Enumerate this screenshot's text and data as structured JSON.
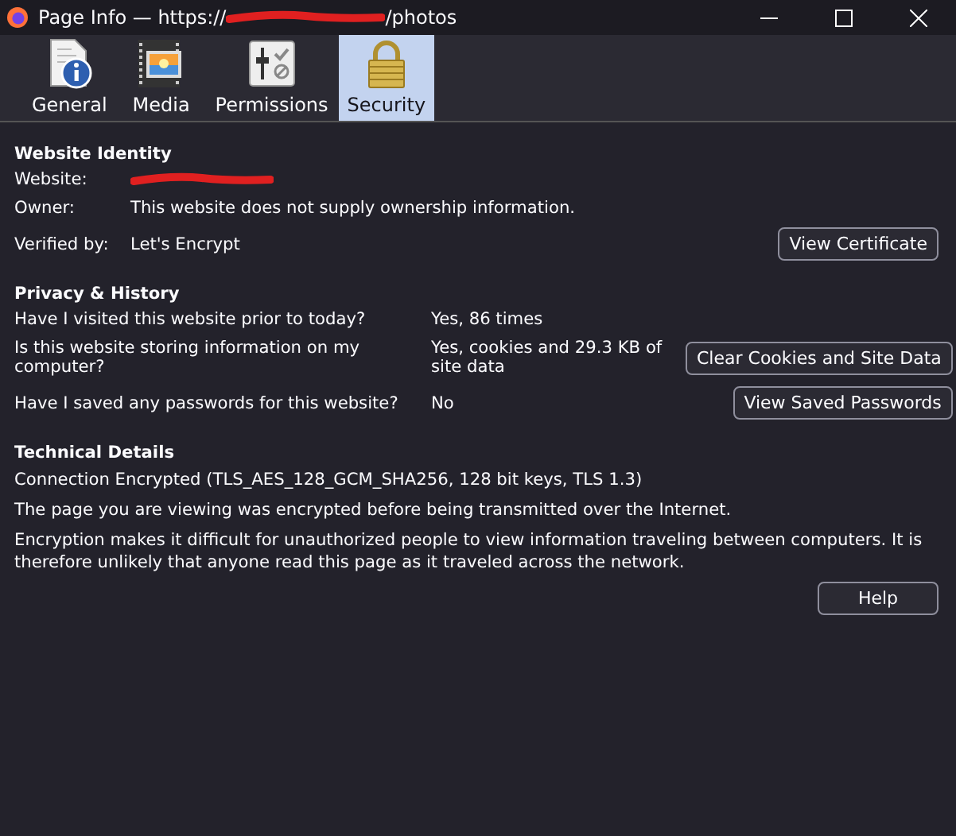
{
  "window": {
    "title_prefix": "Page Info — https://",
    "title_suffix": "/photos"
  },
  "tabs": [
    {
      "label": "General",
      "kind": "document",
      "selected": false
    },
    {
      "label": "Media",
      "kind": "film",
      "selected": false
    },
    {
      "label": "Permissions",
      "kind": "sliders",
      "selected": false
    },
    {
      "label": "Security",
      "kind": "padlock",
      "selected": true
    }
  ],
  "identity": {
    "heading": "Website Identity",
    "website_label": "Website:",
    "owner_label": "Owner:",
    "owner": "This website does not supply ownership information.",
    "verified_label": "Verified by:",
    "verified": "Let's Encrypt",
    "button": "View Certificate"
  },
  "privacy": {
    "heading": "Privacy & History",
    "rows": [
      {
        "question": "Have I visited this website prior to today?",
        "answer": "Yes, 86 times"
      },
      {
        "question": "Is this website storing information on my computer?",
        "answer": "Yes, cookies and 29.3 KB of site data",
        "button": "Clear Cookies and Site Data"
      },
      {
        "question": "Have I saved any passwords for this website?",
        "answer": "No",
        "button": "View Saved Passwords"
      }
    ]
  },
  "technical": {
    "heading": "Technical Details",
    "lines": [
      "Connection Encrypted (TLS_AES_128_GCM_SHA256, 128 bit keys, TLS 1.3)",
      "The page you are viewing was encrypted before being transmitted over the Internet.",
      "Encryption makes it difficult for unauthorized people to view information traveling between computers. It is therefore unlikely that anyone read this page as it traveled across the network."
    ]
  },
  "help_button": "Help"
}
